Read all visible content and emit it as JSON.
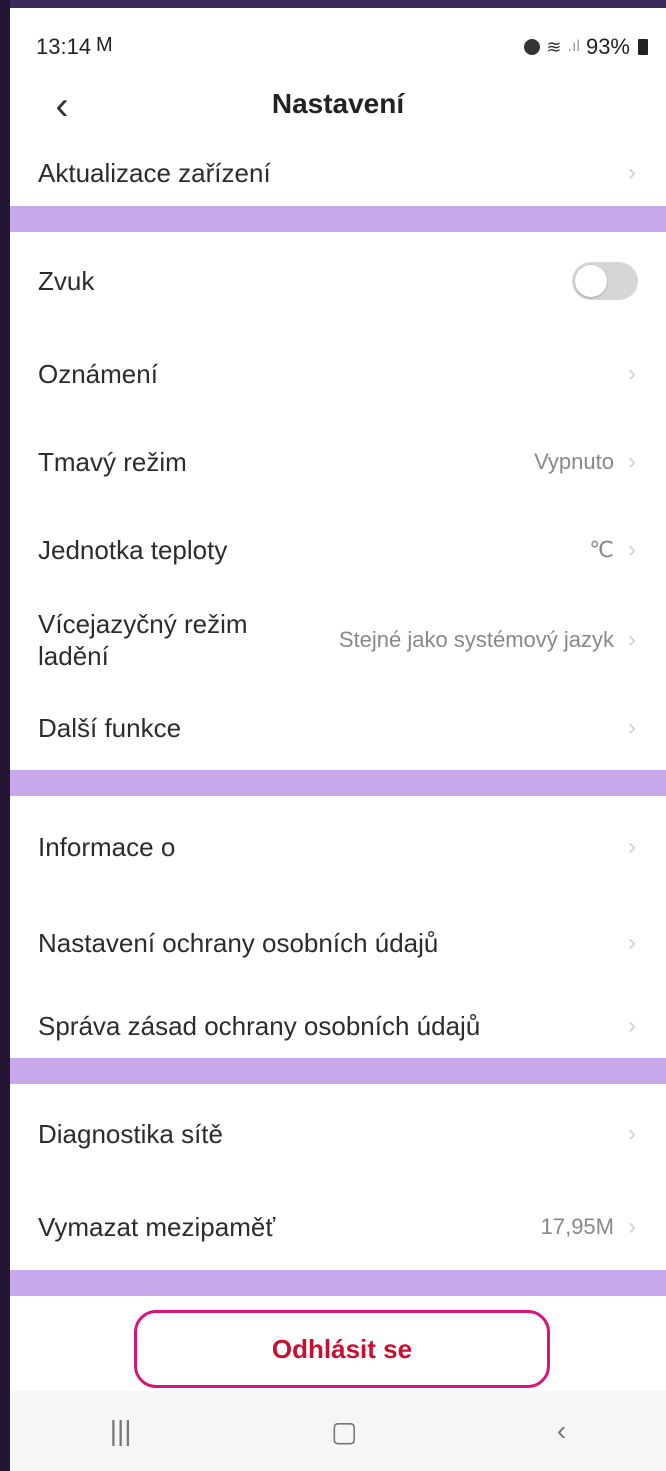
{
  "status_bar": {
    "time": "13:14",
    "mail_icon": "M",
    "battery": "93%"
  },
  "header": {
    "title": "Nastavení",
    "back_icon": "‹"
  },
  "sections": {
    "device_update": "Aktualizace zařízení",
    "sound": "Zvuk",
    "notifications": "Oznámení",
    "dark_mode": {
      "label": "Tmavý režim",
      "value": "Vypnuto"
    },
    "temp_unit": {
      "label": "Jednotka teploty",
      "value": "℃"
    },
    "language_mode": {
      "label": "Vícejazyčný režim ladění",
      "value": "Stejné jako systémový jazyk"
    },
    "more_features": "Další funkce",
    "about": "Informace o",
    "privacy_settings": "Nastavení ochrany osobních údajů",
    "privacy_policy": "Správa zásad ochrany osobních údajů",
    "network_diag": "Diagnostika sítě",
    "clear_cache": {
      "label": "Vymazat mezipaměť",
      "value": "17,95M"
    }
  },
  "logout": "Odhlásit se",
  "colors": {
    "separator": "#c7a8ea",
    "logout_border": "#d9137a",
    "logout_text": "#c8102e"
  },
  "icons": {
    "chevron": "›",
    "nav_recent": "|||",
    "nav_home": "▢",
    "nav_back": "‹"
  }
}
